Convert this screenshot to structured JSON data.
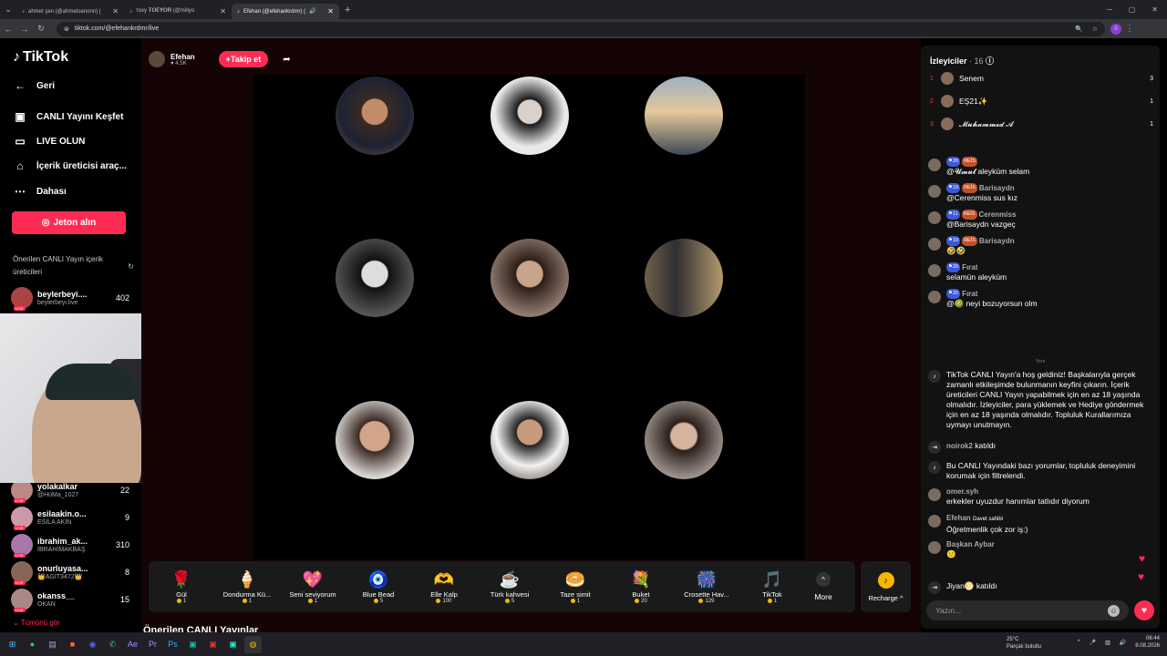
{
  "browser": {
    "tabs": [
      {
        "title": "ahmet şen (@ahmetsenonn) |",
        "active": false
      },
      {
        "title": "тоху 𝐓𝐎𝐄𝐘𝐎𝐑 (@millyo",
        "active": false
      },
      {
        "title": "Efehan (@efehankrdmr) (",
        "active": true
      }
    ],
    "url": "tiktok.com/@efehankrdmr/live",
    "profile_initial": "0"
  },
  "sidebar": {
    "logo": "TikTok",
    "back": "Geri",
    "items": [
      {
        "label": "CANLI Yayını Keşfet",
        "icon": "live-tv-icon"
      },
      {
        "label": "LIVE OLUN",
        "icon": "camera-icon"
      },
      {
        "label": "İçerik üreticisi araç...",
        "icon": "house-icon"
      },
      {
        "label": "Dahası",
        "icon": "ellipsis-icon"
      }
    ],
    "jeton_button": "Jeton alın",
    "suggested_title": "Önerilen CANLI Yayın içerik üreticileri",
    "creators_top": [
      {
        "name": "beylerbeyi....",
        "handle": "beylerbeyi.live",
        "count": "402"
      }
    ],
    "creators": [
      {
        "name": "yolakalkar",
        "handle": "@HüMa_1027",
        "count": "22"
      },
      {
        "name": "esilaakin.o...",
        "handle": "ESİLA AKIN",
        "count": "9"
      },
      {
        "name": "ibrahim_ak...",
        "handle": "İBRAHİMAKBAŞ",
        "count": "310"
      },
      {
        "name": "onurluyasa...",
        "handle": "👑AGİT3472👑",
        "count": "8"
      },
      {
        "name": "okanss__",
        "handle": "OKAN",
        "count": "15"
      }
    ],
    "see_all": "Tümünü gör"
  },
  "stream": {
    "host_name": "Efehan",
    "host_likes": "♥ 4.5K",
    "follow_label": "+Takip et",
    "bottom_title": "Önerilen CANLI Yayınlar"
  },
  "gifts": [
    {
      "name": "Gül",
      "price": "1",
      "icon": "🌹"
    },
    {
      "name": "Dondurma Kü...",
      "price": "1",
      "icon": "🍦"
    },
    {
      "name": "Seni seviyorum",
      "price": "1",
      "icon": "💖"
    },
    {
      "name": "Blue Bead",
      "price": "5",
      "icon": "🧿"
    },
    {
      "name": "Elle Kalp",
      "price": "100",
      "icon": "🫶"
    },
    {
      "name": "Türk kahvesi",
      "price": "5",
      "icon": "☕"
    },
    {
      "name": "Taze simit",
      "price": "1",
      "icon": "🥯"
    },
    {
      "name": "Buket",
      "price": "20",
      "icon": "💐"
    },
    {
      "name": "Crosette Hav...",
      "price": "129",
      "icon": "🎆"
    },
    {
      "name": "TikTok",
      "price": "1",
      "icon": "🎵"
    }
  ],
  "gift_more": "More",
  "recharge": "Recharge ^",
  "viewers": {
    "title": "İzleyiciler",
    "count": "· 16",
    "top": [
      {
        "rank": "1",
        "name": "Senem",
        "count": "3"
      },
      {
        "rank": "2",
        "name": "EŞ21✨",
        "count": "1"
      },
      {
        "rank": "3",
        "name": "𝓜𝓾𝓱𝓪𝓶𝓶𝓮𝓭 𝓐",
        "count": "1"
      }
    ]
  },
  "chat": {
    "messages": [
      {
        "level": "20",
        "reis": "REİS",
        "user": "",
        "text": "@𝓤𝓶𝓾𝓽 aleyküm selam"
      },
      {
        "level": "19",
        "reis": "REİS",
        "user": "Barisaydn",
        "text": "@Cerenmiss sus kız"
      },
      {
        "level": "11",
        "reis": "REİS",
        "user": "Cerenmiss",
        "text": "@Barisaydn vazgeç"
      },
      {
        "level": "19",
        "reis": "REİS",
        "user": "Barisaydn",
        "text": "🤣🤣"
      },
      {
        "level": "20",
        "reis": "",
        "user": "Fırat",
        "text": "selamün aleyküm"
      },
      {
        "level": "20",
        "reis": "",
        "user": "Fırat",
        "text": "@🥝 neyi bozuyorsun olm"
      }
    ],
    "separator": "Yeni",
    "welcome": "TikTok CANLI Yayın'a hoş geldiniz! Başkalarıyla gerçek zamanlı etkileşimde bulunmanın keyfini çıkarın. İçerik üreticileri CANLI Yayın yapabilmek için en az 18 yaşında olmalıdır. İzleyiciler, para yüklemek ve Hediye göndermek için en az 18 yaşında olmalıdır. Topluluk Kurallarımıza uymayı unutmayın.",
    "join1_user": "noirok2",
    "joined": "katıldı",
    "filter_notice": "Bu CANLI Yayındaki bazı yorumlar, topluluk deneyimini korumak için filtrelendi.",
    "m1_user": "omer.syh",
    "m1_text": "erkekler uyuzdur hanımlar tatlıdır diyorum",
    "m2_user": "Efehan",
    "m2_tag": "Davet sahibi",
    "m2_text": "Öğretmenlik çok zor iş:)",
    "m3_user": "Başkan Aybar",
    "m3_text": "😕",
    "join2_user": "Jiyan🌕",
    "input_placeholder": "Yazın..."
  },
  "taskbar": {
    "temp": "25°C",
    "weather": "Parçalı bulutlu",
    "time": "06:44",
    "date": "8.08.2026"
  }
}
